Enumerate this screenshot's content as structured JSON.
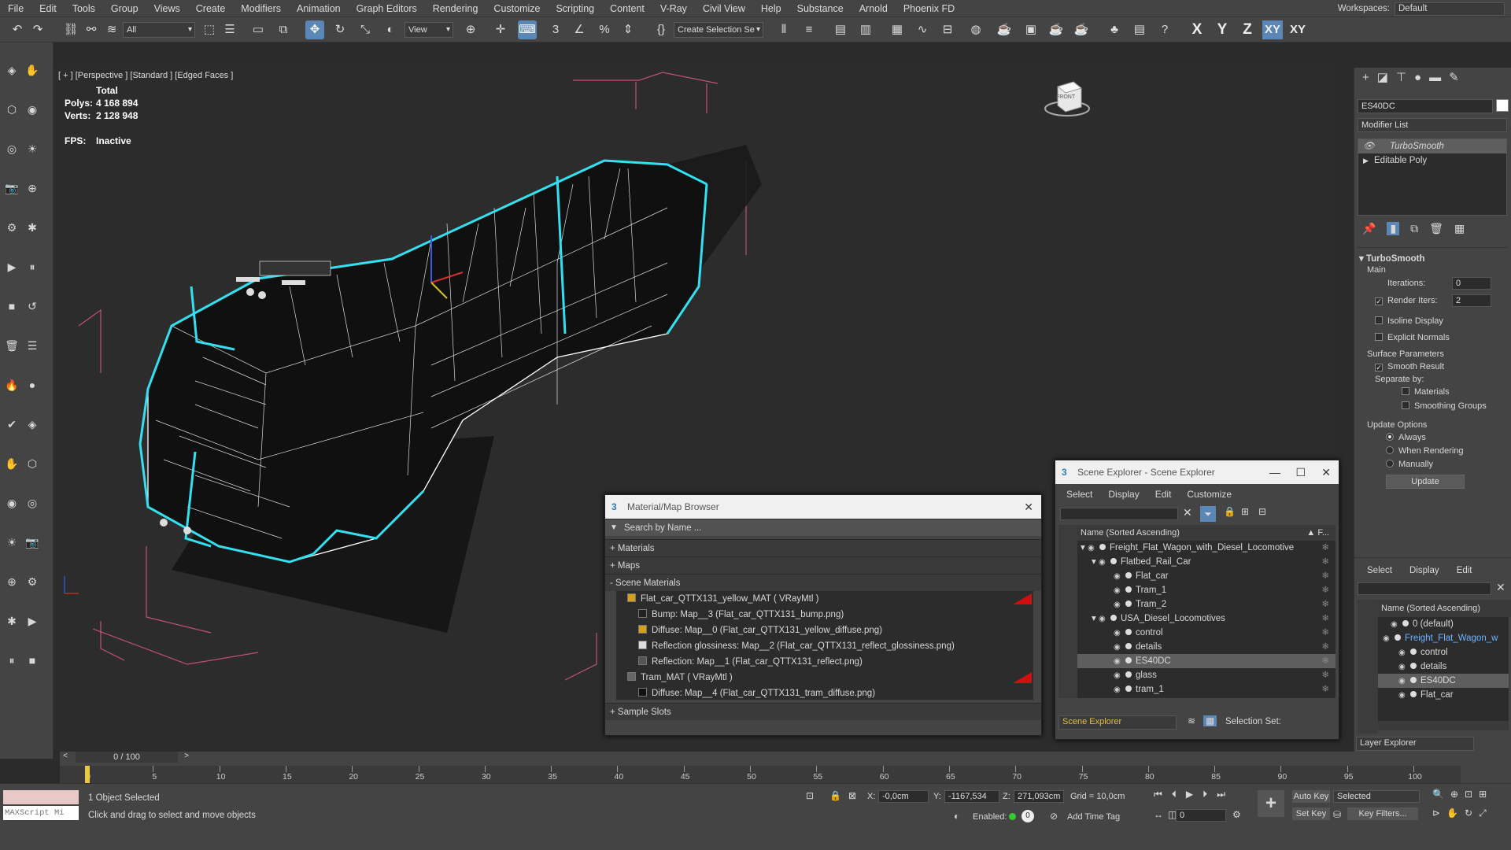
{
  "menu": [
    "File",
    "Edit",
    "Tools",
    "Group",
    "Views",
    "Create",
    "Modifiers",
    "Animation",
    "Graph Editors",
    "Rendering",
    "Customize",
    "Scripting",
    "Content",
    "V-Ray",
    "Civil View",
    "Help",
    "Substance",
    "Arnold",
    "Phoenix FD"
  ],
  "workspace": {
    "label": "Workspaces:",
    "value": "Default"
  },
  "toolbar": {
    "filter": "All",
    "refcoord": "View",
    "selset": "Create Selection Se",
    "axes": [
      "X",
      "Y",
      "Z",
      "XY",
      "XY"
    ]
  },
  "viewport": {
    "label": "[ + ] [Perspective ] [Standard ] [Edged Faces ]",
    "stats": {
      "total": "Total",
      "polys_label": "Polys:",
      "polys": "4 168 894",
      "verts_label": "Verts:",
      "verts": "2 128 948",
      "fps_label": "FPS:",
      "fps": "Inactive"
    },
    "viewcube_label": "FRONT"
  },
  "command_panel": {
    "object_name": "ES40DC",
    "modifier_list": "Modifier List",
    "stack": [
      "TurboSmooth",
      "Editable Poly"
    ],
    "rollout_title": "TurboSmooth",
    "main": "Main",
    "iterations_label": "Iterations:",
    "iterations": "0",
    "render_iters_label": "Render Iters:",
    "render_iters": "2",
    "isoline": "Isoline Display",
    "explicit": "Explicit Normals",
    "surface": "Surface Parameters",
    "smooth": "Smooth Result",
    "separate": "Separate by:",
    "materials": "Materials",
    "smgroups": "Smoothing Groups",
    "update_opts": "Update Options",
    "always": "Always",
    "when_rendering": "When Rendering",
    "manually": "Manually",
    "update_btn": "Update"
  },
  "layer_explorer": {
    "menu": [
      "Select",
      "Display",
      "Edit"
    ],
    "header": "Name (Sorted Ascending)",
    "rows": [
      "0 (default)",
      "Freight_Flat_Wagon_w",
      "control",
      "details",
      "ES40DC",
      "Flat_car"
    ],
    "footer": "Layer Explorer"
  },
  "material_browser": {
    "title": "Material/Map Browser",
    "search": "Search by Name ...",
    "sections": [
      "+ Materials",
      "+ Maps",
      "- Scene Materials",
      "+ Sample Slots"
    ],
    "rows": [
      {
        "text": "Flat_car_QTTX131_yellow_MAT  ( VRayMtl )",
        "indent": 0,
        "color": "#d4a017"
      },
      {
        "text": "Bump: Map__3 (Flat_car_QTTX131_bump.png)",
        "indent": 1,
        "color": "#222222"
      },
      {
        "text": "Diffuse: Map__0 (Flat_car_QTTX131_yellow_diffuse.png)",
        "indent": 1,
        "color": "#d4a017"
      },
      {
        "text": "Reflection glossiness: Map__2 (Flat_car_QTTX131_reflect_glossiness.png)",
        "indent": 1,
        "color": "#dddddd"
      },
      {
        "text": "Reflection: Map__1 (Flat_car_QTTX131_reflect.png)",
        "indent": 1,
        "color": "#555555"
      },
      {
        "text": "Tram_MAT  ( VRayMtl )",
        "indent": 0,
        "color": "#666666"
      },
      {
        "text": "Diffuse: Map__4 (Flat_car_QTTX131_tram_diffuse.png)",
        "indent": 1,
        "color": "#111111"
      }
    ]
  },
  "scene_explorer": {
    "title": "Scene Explorer - Scene Explorer",
    "menu": [
      "Select",
      "Display",
      "Edit",
      "Customize"
    ],
    "header": "Name (Sorted Ascending)",
    "header_right": "▲ F...",
    "rows": [
      {
        "text": "Freight_Flat_Wagon_with_Diesel_Locomotive",
        "level": 0
      },
      {
        "text": "Flatbed_Rail_Car",
        "level": 1
      },
      {
        "text": "Flat_car",
        "level": 2
      },
      {
        "text": "Tram_1",
        "level": 2
      },
      {
        "text": "Tram_2",
        "level": 2
      },
      {
        "text": "USA_Diesel_Locomotives",
        "level": 1
      },
      {
        "text": "control",
        "level": 2
      },
      {
        "text": "details",
        "level": 2
      },
      {
        "text": "ES40DC",
        "level": 2
      },
      {
        "text": "glass",
        "level": 2
      },
      {
        "text": "tram_1",
        "level": 2
      },
      {
        "text": "tram_2",
        "level": 2
      }
    ],
    "footer": "Scene Explorer",
    "selection_set": "Selection Set:"
  },
  "timeline": {
    "frame": "0 / 100",
    "ticks": [
      "0",
      "5",
      "10",
      "15",
      "20",
      "25",
      "30",
      "35",
      "40",
      "45",
      "50",
      "55",
      "60",
      "65",
      "70",
      "75",
      "80",
      "85",
      "90",
      "95",
      "100"
    ]
  },
  "status": {
    "maxscript": "MAXScript Mi",
    "selected": "1 Object Selected",
    "prompt": "Click and drag to select and move objects",
    "x_label": "X:",
    "x": "-0,0cm",
    "y_label": "Y:",
    "y": "-1167,534",
    "z_label": "Z:",
    "z": "271,093cm",
    "grid": "Grid = 10,0cm",
    "enabled": "Enabled:",
    "enabled_val": "0",
    "add_time_tag": "Add Time Tag",
    "auto_key": "Auto Key",
    "set_key": "Set Key",
    "key_filters": "Key Filters...",
    "selected_dd": "Selected",
    "frame_field": "0"
  }
}
